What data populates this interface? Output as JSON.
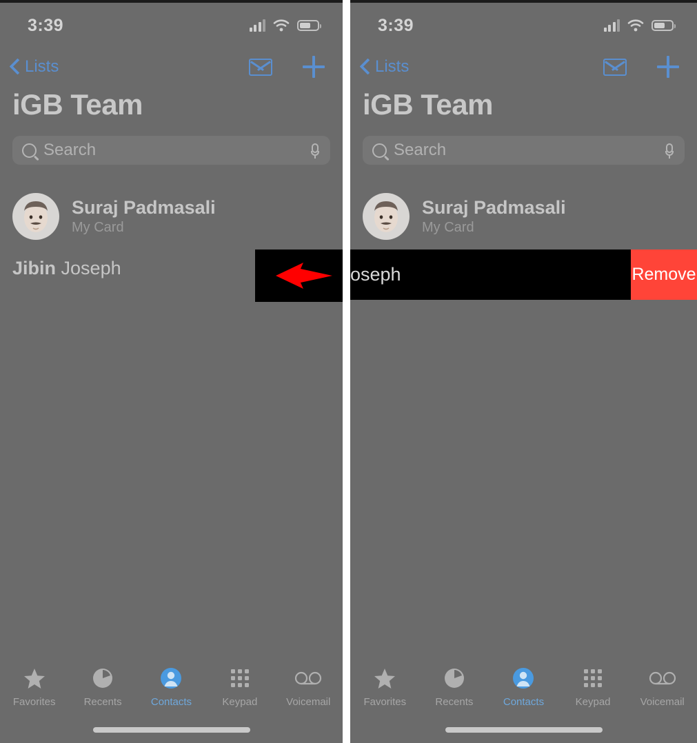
{
  "panels": [
    {
      "id": "left",
      "status": {
        "time": "3:39",
        "signal_icon": "cellular-signal-icon",
        "wifi_icon": "wifi-icon",
        "battery_icon": "battery-icon"
      },
      "nav": {
        "back_label": "Lists",
        "back_icon": "chevron-left-icon",
        "mail_icon": "envelope-icon",
        "add_icon": "plus-icon"
      },
      "title": "iGB Team",
      "search": {
        "placeholder": "Search",
        "value": "",
        "search_icon": "magnifier-icon",
        "dictate_icon": "microphone-icon"
      },
      "my_card": {
        "name": "Suraj Padmasali",
        "subtitle": "My Card",
        "avatar_icon": "memoji-avatar"
      },
      "contact": {
        "first_name": "Jibin",
        "last_name": "Joseph"
      },
      "annotation": {
        "type": "arrow",
        "direction": "left",
        "color": "#ff0000",
        "background": "#000000"
      },
      "swipe_action": null
    },
    {
      "id": "right",
      "status": {
        "time": "3:39",
        "signal_icon": "cellular-signal-icon",
        "wifi_icon": "wifi-icon",
        "battery_icon": "battery-icon"
      },
      "nav": {
        "back_label": "Lists",
        "back_icon": "chevron-left-icon",
        "mail_icon": "envelope-icon",
        "add_icon": "plus-icon"
      },
      "title": "iGB Team",
      "search": {
        "placeholder": "Search",
        "value": "",
        "search_icon": "magnifier-icon",
        "dictate_icon": "microphone-icon"
      },
      "my_card": {
        "name": "Suraj Padmasali",
        "subtitle": "My Card",
        "avatar_icon": "memoji-avatar"
      },
      "contact": {
        "first_name": "",
        "last_name": "oseph"
      },
      "annotation": null,
      "swipe_action": {
        "label": "Remove",
        "color": "#ff4438"
      }
    }
  ],
  "tabbar": {
    "items": [
      {
        "label": "Favorites",
        "icon": "star-icon",
        "active": false
      },
      {
        "label": "Recents",
        "icon": "clock-icon",
        "active": false
      },
      {
        "label": "Contacts",
        "icon": "person-circle-icon",
        "active": true
      },
      {
        "label": "Keypad",
        "icon": "dialpad-icon",
        "active": false
      },
      {
        "label": "Voicemail",
        "icon": "voicemail-icon",
        "active": false
      }
    ]
  },
  "colors": {
    "accent_blue": "#5a8fd0",
    "active_tab_blue": "#6fa8dc",
    "destructive_red": "#ff4438",
    "annotation_red": "#ff0000",
    "overlay_gray": "#6b6b6b"
  }
}
